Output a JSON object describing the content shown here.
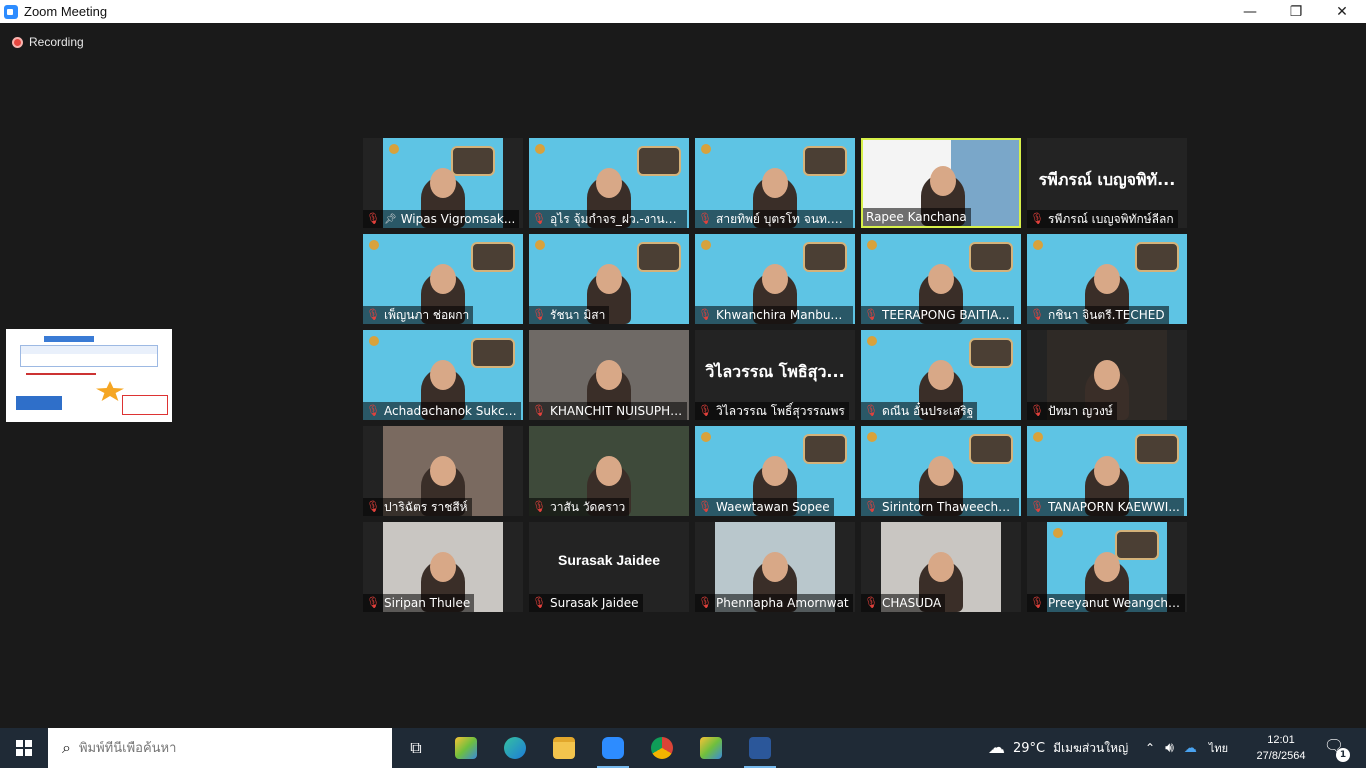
{
  "window": {
    "title": "Zoom Meeting",
    "minimize": "—",
    "maximize": "❐",
    "close": "✕"
  },
  "recording": {
    "label": "Recording"
  },
  "gallery": {
    "tiles": [
      {
        "name": "Wipas Vigromsak...",
        "muted": true,
        "pinned": true
      },
      {
        "name": "อุไร จุ้มกำจร_ฝว.-งานประ...",
        "muted": true
      },
      {
        "name": "สายทิพย์ บุตรโท จนท.ปร...",
        "muted": true
      },
      {
        "name": "Rapee Kanchana",
        "muted": false,
        "active": true
      },
      {
        "name": "รพีภรณ์ เบญจพิทักษ์ลีลก",
        "muted": true,
        "display_name": "รพีภรณ์ เบญจพิทั..."
      },
      {
        "name": "เพ็ญนภา ช่อผกา",
        "muted": true
      },
      {
        "name": "รัชนา มิสา",
        "muted": true
      },
      {
        "name": "Khwanchira Manbum...",
        "muted": true
      },
      {
        "name": "TEERAPONG BAITIA...",
        "muted": true
      },
      {
        "name": "กชินา จินตรี.TECHED",
        "muted": true
      },
      {
        "name": "Achadachanok Sukch...",
        "muted": true
      },
      {
        "name": "KHANCHIT NUISUPHAP",
        "muted": true
      },
      {
        "name": "วิไลวรรณ โพธิ์สุวรรณพร",
        "muted": true,
        "display_name": "วิไลวรรณ โพธิสุว..."
      },
      {
        "name": "ดณีน อั๋นประเสริฐ",
        "muted": true
      },
      {
        "name": "ปัทมา ญวงษ์",
        "muted": true
      },
      {
        "name": "ปาริฉัตร ราชสีห์",
        "muted": true
      },
      {
        "name": "วาสัน วัดคราว",
        "muted": true
      },
      {
        "name": "Waewtawan Sopee",
        "muted": true
      },
      {
        "name": "Sirintorn Thaweechart",
        "muted": true
      },
      {
        "name": "TANAPORN KAEWWI...",
        "muted": true
      },
      {
        "name": "Siripan Thulee",
        "muted": true
      },
      {
        "name": "Surasak Jaidee",
        "muted": true,
        "display_name": "Surasak Jaidee"
      },
      {
        "name": "Phennapha Amornwat",
        "muted": true
      },
      {
        "name": "CHASUDA",
        "muted": true
      },
      {
        "name": "Preeyanut Weangcha...",
        "muted": true
      }
    ]
  },
  "taskbar": {
    "search_placeholder": "พิมพ์ที่นี่เพื่อค้นหา",
    "weather": {
      "temp": "29°C",
      "desc": "มีเมฆส่วนใหญ่"
    },
    "language": "ไทย",
    "time": "12:01",
    "date": "27/8/2564",
    "notification_count": "1"
  }
}
